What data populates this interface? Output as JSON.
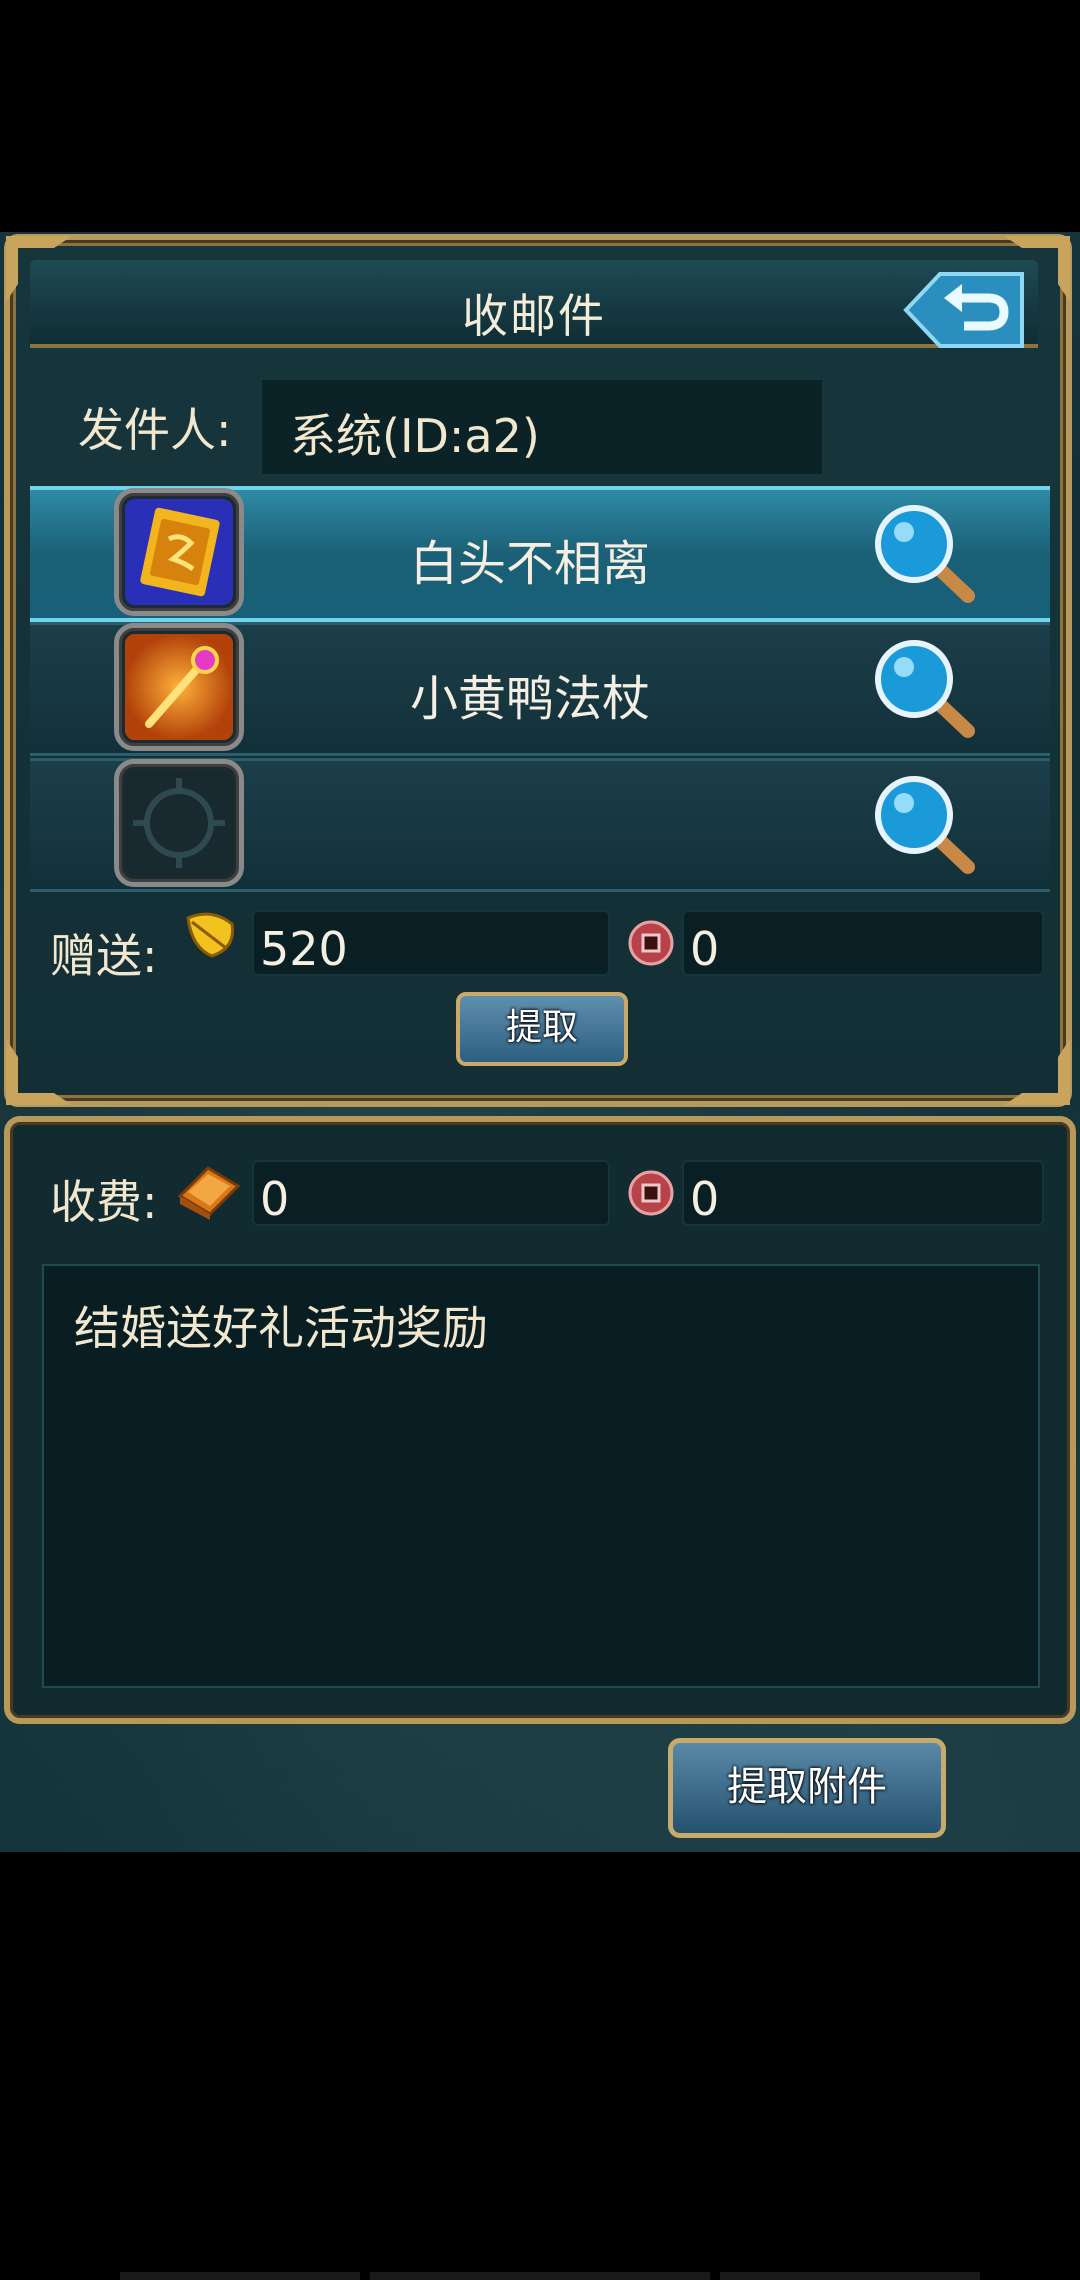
{
  "window": {
    "title": "收邮件"
  },
  "sender": {
    "label": "发件人:",
    "value": "系统(ID:a2)"
  },
  "attachments": [
    {
      "name": "白头不相离",
      "icon": "card-icon",
      "selected": true
    },
    {
      "name": "小黄鸭法杖",
      "icon": "staff-icon",
      "selected": false
    },
    {
      "name": "",
      "icon": "empty-slot-icon",
      "selected": false
    }
  ],
  "gift": {
    "label": "赠送:",
    "amount": "520",
    "coin_amount": "0"
  },
  "take_button": "提取",
  "fee": {
    "label": "收费:",
    "amount": "0",
    "coin_amount": "0"
  },
  "message": "结婚送好礼活动奖励",
  "take_attachment_button": "提取附件",
  "colors": {
    "gold_border": "#b79a5b",
    "panel_bg": "#143138",
    "selected_row": "#1b6076"
  }
}
